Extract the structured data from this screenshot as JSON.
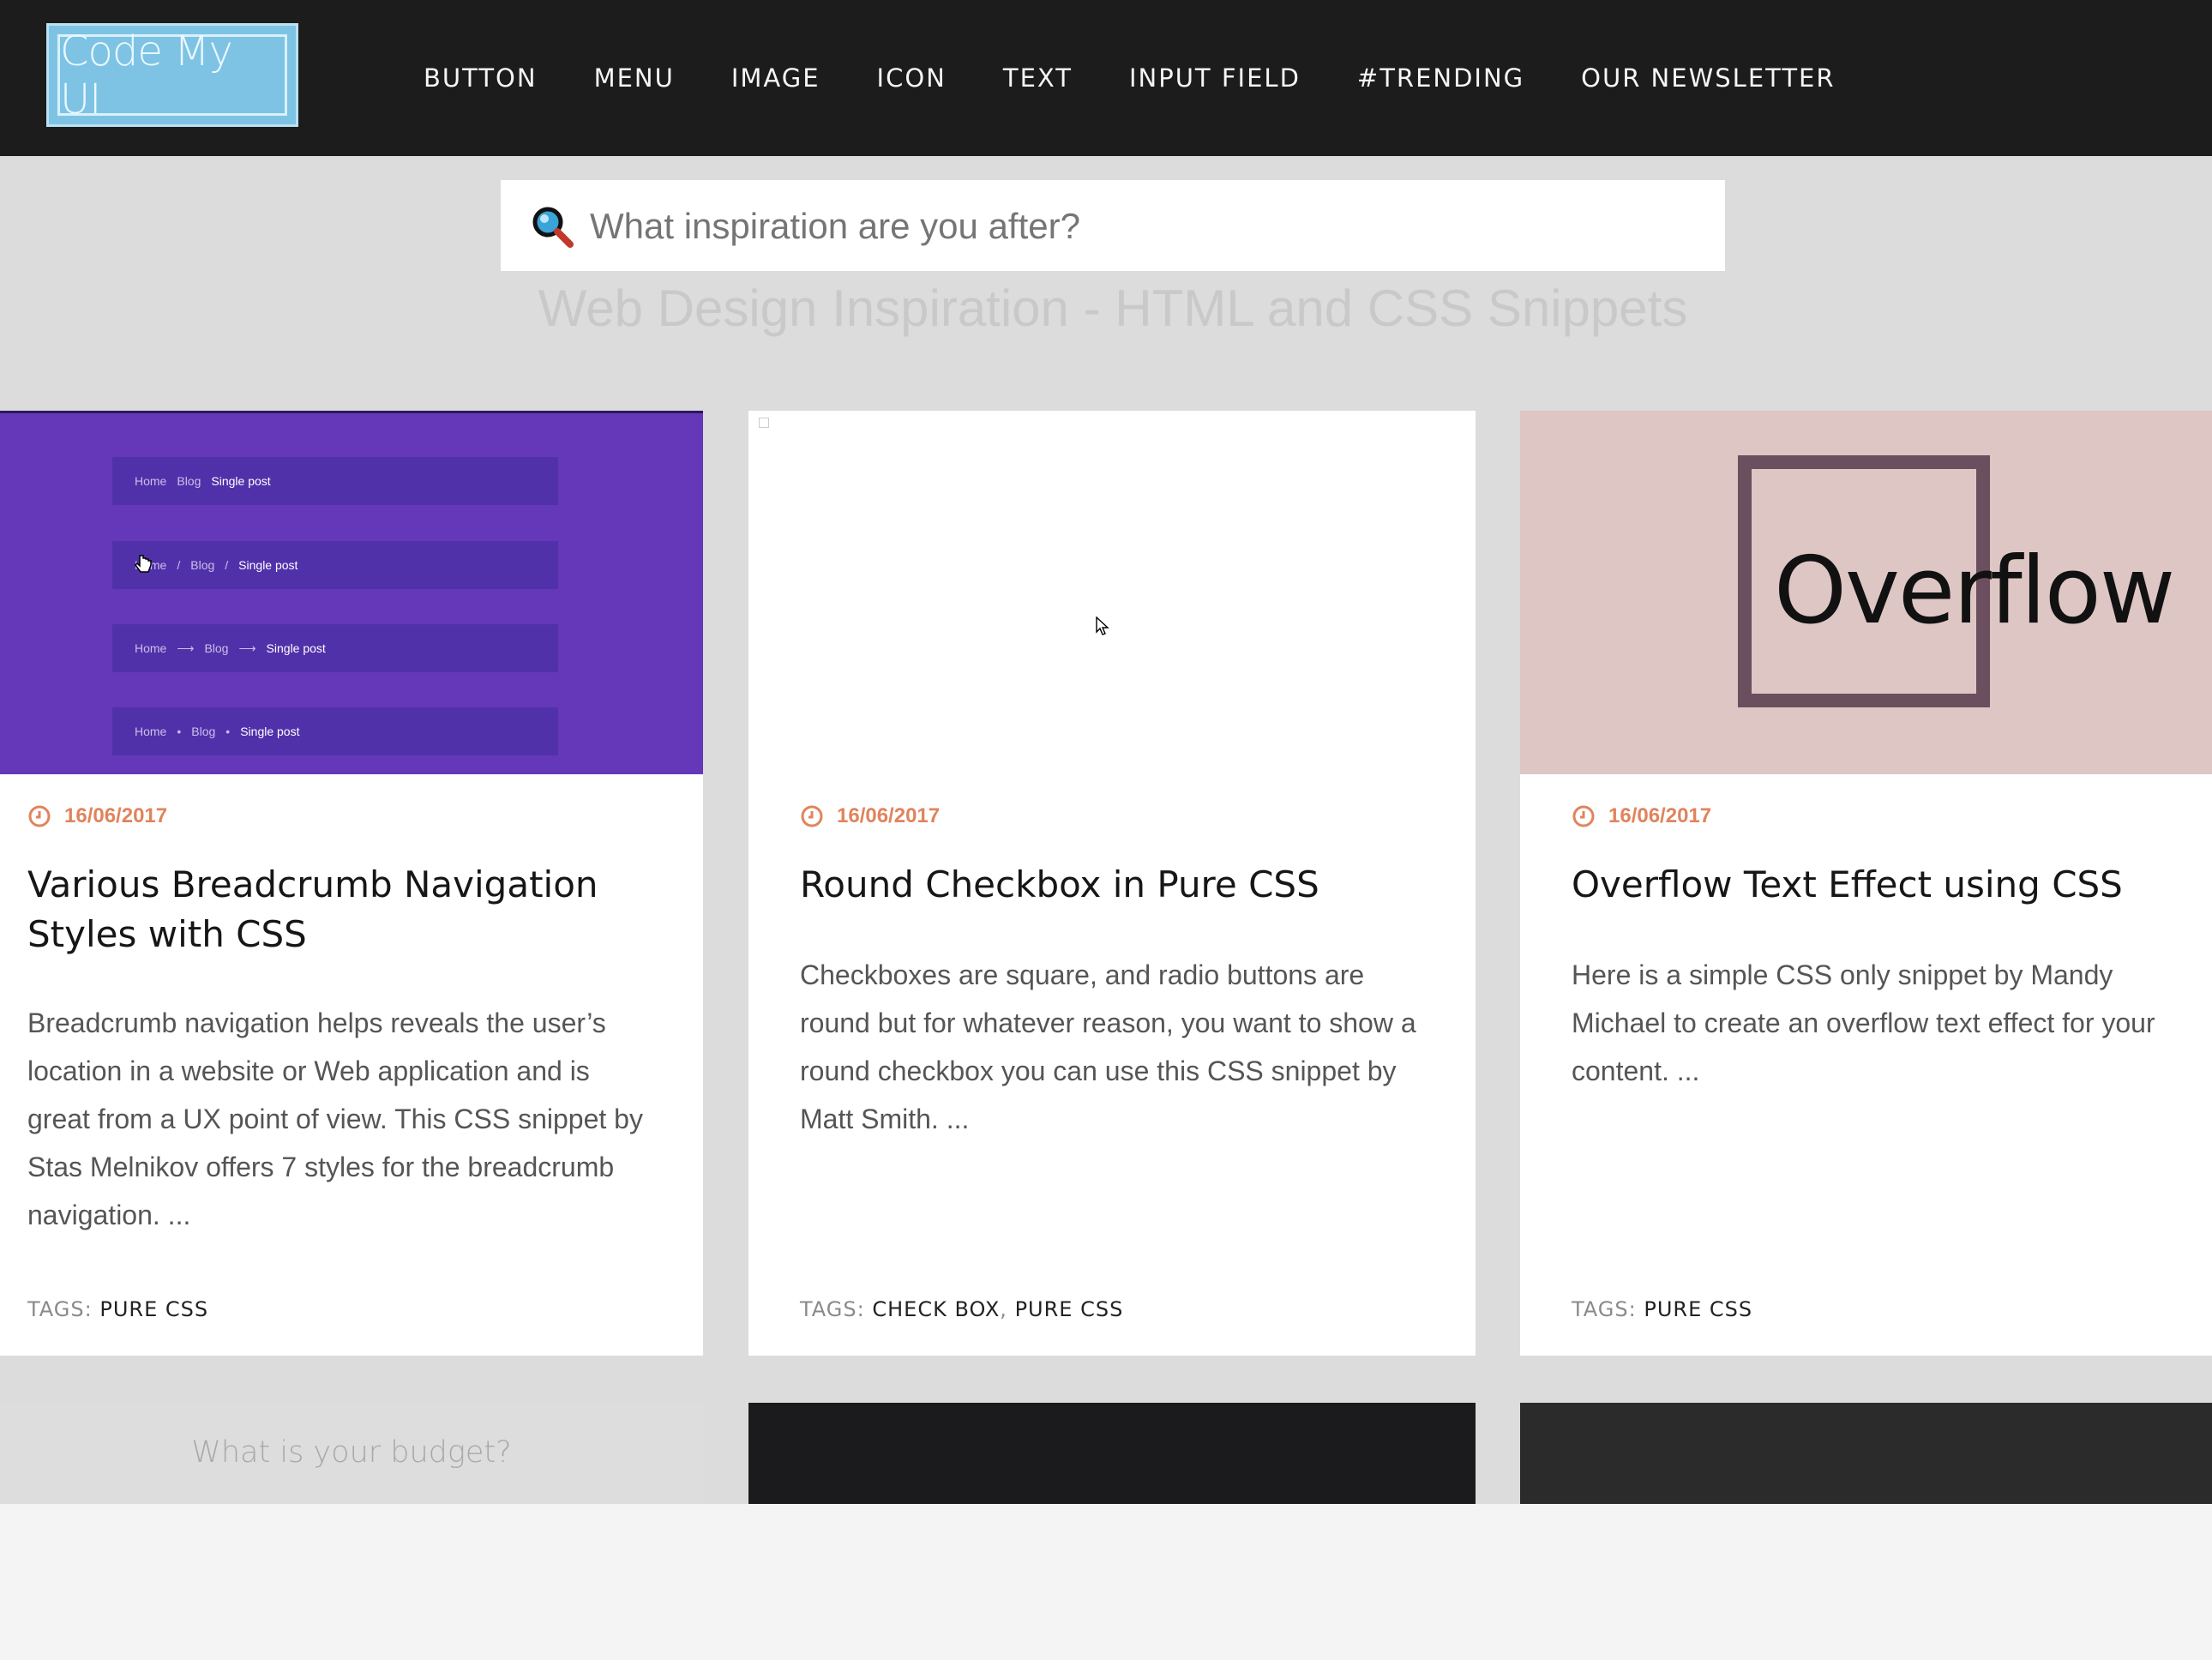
{
  "header": {
    "logo_text": "Code My UI",
    "nav": [
      "BUTTON",
      "MENU",
      "IMAGE",
      "ICON",
      "TEXT",
      "INPUT FIELD",
      "#TRENDING",
      "OUR NEWSLETTER"
    ]
  },
  "search": {
    "placeholder": "What inspiration are you after?",
    "icon": "magnifier-icon"
  },
  "hero": {
    "tagline": "Web Design Inspiration - HTML and CSS Snippets"
  },
  "cards": [
    {
      "date": "16/06/2017",
      "title": "Various Breadcrumb Navigation Styles with CSS",
      "description": "Breadcrumb navigation helps reveals the user’s location in a website or Web application and is great from a UX point of view. This CSS snippet by Stas Melnikov offers 7 styles for the breadcrumb navigation. ...",
      "tags_label": "TAGS:",
      "tags": [
        "PURE CSS"
      ],
      "thumbnail": {
        "rows": [
          {
            "items": [
              "Home",
              "Blog",
              "Single post"
            ],
            "sep": ""
          },
          {
            "items": [
              "Home",
              "Blog",
              "Single post"
            ],
            "sep": "/"
          },
          {
            "items": [
              "Home",
              "Blog",
              "Single post"
            ],
            "sep": "⟶"
          },
          {
            "items": [
              "Home",
              "Blog",
              "Single post"
            ],
            "sep": "•"
          }
        ]
      }
    },
    {
      "date": "16/06/2017",
      "title": "Round Checkbox in Pure CSS",
      "description": "Checkboxes are square, and radio buttons are round but for whatever reason, you want to show a round checkbox you can use this CSS snippet by Matt Smith. ...",
      "tags_label": "TAGS:",
      "tags": [
        "CHECK BOX",
        "PURE CSS"
      ]
    },
    {
      "date": "16/06/2017",
      "title": "Overflow Text Effect using CSS",
      "description": "Here is a simple CSS only snippet by Mandy Michael to create an overflow text effect for your content. ...",
      "tags_label": "TAGS:",
      "tags": [
        "PURE CSS"
      ],
      "thumbnail": {
        "word": "Overflow"
      }
    }
  ],
  "row2": {
    "budget_text": "What is your budget?"
  },
  "colors": {
    "header_bg": "#1c1c1c",
    "hero_bg": "#dcdcdc",
    "date_accent": "#e0845c",
    "breadcrumb_bg": "#6438b8",
    "overflow_bg": "#dec6c4"
  }
}
